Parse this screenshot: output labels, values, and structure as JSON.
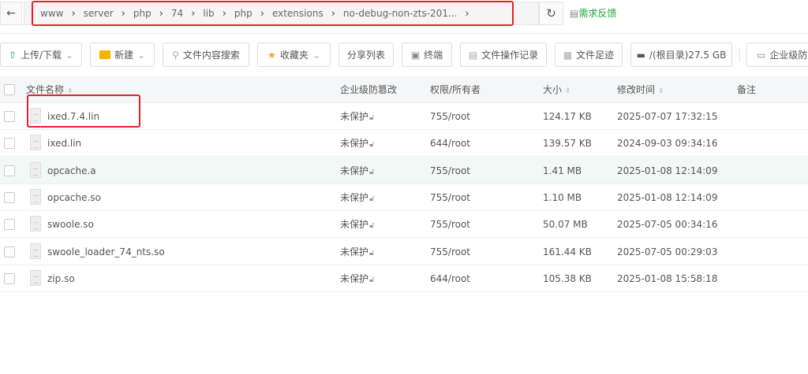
{
  "nav": {
    "back_icon": "arrow-left-icon",
    "breadcrumbs": [
      "www",
      "server",
      "php",
      "74",
      "lib",
      "php",
      "extensions",
      "no-debug-non-zts-201..."
    ],
    "refresh_icon": "refresh-icon",
    "feedback": "需求反馈"
  },
  "toolbar": {
    "upload": "上传/下载",
    "new": "新建",
    "search": "文件内容搜索",
    "favorites": "收藏夹",
    "share": "分享列表",
    "terminal": "终端",
    "oplog": "文件操作记录",
    "footprint": "文件足迹",
    "disk": "/(根目录)27.5 GB",
    "enterprise": "企业级防篡改"
  },
  "table": {
    "headers": {
      "name": "文件名称",
      "protect": "企业级防篡改",
      "perm": "权限/所有者",
      "size": "大小",
      "mtime": "修改时间",
      "note": "备注"
    },
    "rows": [
      {
        "name": "ixed.7.4.lin",
        "protect": "未保护",
        "perm": "755/root",
        "size": "124.17 KB",
        "mtime": "2025-07-07 17:32:15"
      },
      {
        "name": "ixed.lin",
        "protect": "未保护",
        "perm": "644/root",
        "size": "139.57 KB",
        "mtime": "2024-09-03 09:34:16"
      },
      {
        "name": "opcache.a",
        "protect": "未保护",
        "perm": "755/root",
        "size": "1.41 MB",
        "mtime": "2025-01-08 12:14:09"
      },
      {
        "name": "opcache.so",
        "protect": "未保护",
        "perm": "755/root",
        "size": "1.10 MB",
        "mtime": "2025-01-08 12:14:09"
      },
      {
        "name": "swoole.so",
        "protect": "未保护",
        "perm": "755/root",
        "size": "50.07 MB",
        "mtime": "2025-07-05 00:34:16"
      },
      {
        "name": "swoole_loader_74_nts.so",
        "protect": "未保护",
        "perm": "755/root",
        "size": "161.44 KB",
        "mtime": "2025-07-05 00:29:03"
      },
      {
        "name": "zip.so",
        "protect": "未保护",
        "perm": "644/root",
        "size": "105.38 KB",
        "mtime": "2025-01-08 15:58:18"
      }
    ]
  },
  "colors": {
    "accent": "#20a53a",
    "highlight": "#e8202a",
    "hover_row": "#f2f8f6"
  }
}
